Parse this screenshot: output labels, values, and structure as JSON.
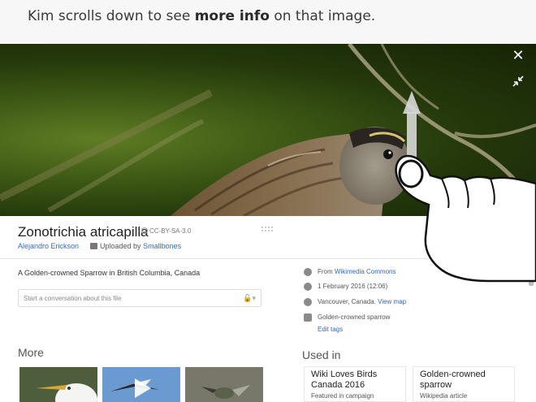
{
  "caption": {
    "before": "Kim scrolls down to see ",
    "bold": "more info",
    "after": " on that image."
  },
  "viewer": {
    "close_icon": "close-icon",
    "shrink_icon": "collapse-icon"
  },
  "file": {
    "title": "Zonotrichia atricapilla",
    "license": "CC-BY-SA-3.0",
    "author": "Alejandro Erickson",
    "uploaded_prefix": "Uploaded by",
    "uploader": "Smallbones",
    "description": "A Golden-crowned Sparrow in British Columbia, Canada",
    "conversation_placeholder": "Start a conversation about this file"
  },
  "metadata": {
    "source_prefix": "From",
    "source": "Wikimedia Commons",
    "date": "1 February 2016 (12:06)",
    "location": "Vancouver, Canada.",
    "location_link": "View map",
    "tag": "Golden-crowned sparrow",
    "edit_tags": "Edit tags"
  },
  "more": {
    "heading": "More"
  },
  "used_in": {
    "heading": "Used in",
    "cards": [
      {
        "title": "Wiki Loves Birds Canada 2016",
        "subtitle": "Featured in campaign"
      },
      {
        "title": "Golden-crowned sparrow",
        "subtitle": "Wikipedia article"
      }
    ]
  },
  "colors": {
    "link": "#3366cc",
    "hero_dark": "#24380b",
    "hero_light": "#5f7d24"
  }
}
